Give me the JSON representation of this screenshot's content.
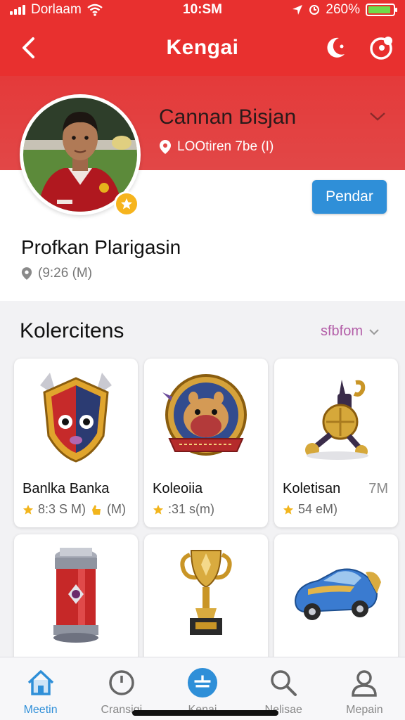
{
  "status_bar": {
    "carrier": "Dorlaam",
    "time": "10:SM",
    "battery": "260%",
    "battery_level": 0.9,
    "icons": [
      "signal-icon",
      "wifi-icon",
      "location-icon",
      "alarm-icon",
      "battery-icon"
    ]
  },
  "nav": {
    "title": "Kengai",
    "back_icon": "back-chevron-icon",
    "action_icons": [
      "moon-icon",
      "notification-icon"
    ]
  },
  "profile": {
    "name": "Cannan Bisjan",
    "location": "LOOtiren 7be (I)",
    "follow_label": "Pendar",
    "subtitle": "Profkan Plarigasin",
    "meta": "(9:26 (M)",
    "badge_icon": "star-badge-icon"
  },
  "collections": {
    "title": "Kolercitens",
    "filter_label": "sfbfom",
    "items": [
      {
        "title": "Banlka Banka",
        "stats": "8:3 S M)",
        "extra": "(M)",
        "side": "",
        "art": "mask-shield-icon"
      },
      {
        "title": "Koleoiia",
        "stats": ":31 s(m)",
        "extra": "",
        "side": "",
        "art": "creature-badge-icon"
      },
      {
        "title": "Koletisan",
        "stats": "54 eM)",
        "extra": "",
        "side": "7M",
        "art": "golden-trophy-robot-icon"
      },
      {
        "title": "",
        "stats": "",
        "extra": "",
        "side": "",
        "art": "red-canister-icon"
      },
      {
        "title": "",
        "stats": "",
        "extra": "",
        "side": "",
        "art": "golden-cup-icon"
      },
      {
        "title": "",
        "stats": "",
        "extra": "",
        "side": "",
        "art": "toy-car-icon"
      }
    ]
  },
  "tabs": [
    {
      "label": "Meetin",
      "icon": "home-icon",
      "active": true
    },
    {
      "label": "Cransigi",
      "icon": "clock-icon",
      "active": false
    },
    {
      "label": "Kenai",
      "icon": "add-circle-icon",
      "active": false
    },
    {
      "label": "Nelisae",
      "icon": "search-icon",
      "active": false
    },
    {
      "label": "Mepain",
      "icon": "profile-icon",
      "active": false
    }
  ],
  "colors": {
    "primary_red": "#e8302f",
    "accent_blue": "#2f8fd8",
    "badge_gold": "#f6b41d",
    "filter_purple": "#b35ea8"
  }
}
